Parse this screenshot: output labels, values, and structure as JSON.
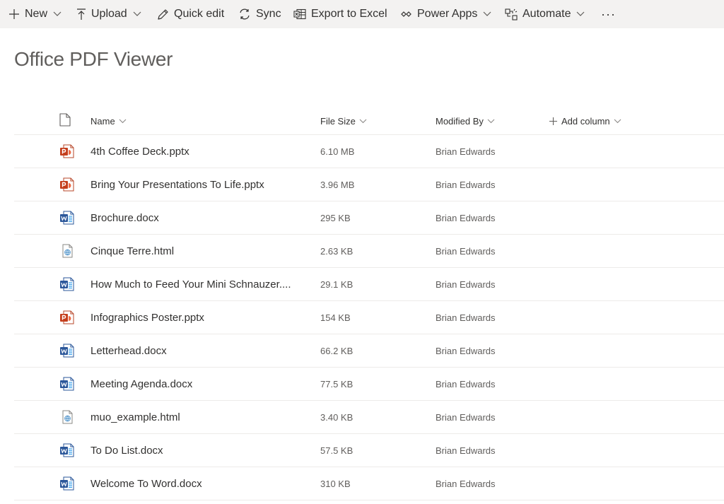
{
  "toolbar": {
    "new_label": "New",
    "upload_label": "Upload",
    "quick_edit_label": "Quick edit",
    "sync_label": "Sync",
    "export_label": "Export to Excel",
    "power_apps_label": "Power Apps",
    "automate_label": "Automate",
    "more_label": "···"
  },
  "page": {
    "title": "Office PDF Viewer"
  },
  "columns": {
    "name": "Name",
    "file_size": "File Size",
    "modified_by": "Modified By",
    "add_column": "Add column"
  },
  "colors": {
    "word": "#2b579a",
    "powerpoint": "#c43e1c",
    "html": "#4a90c8",
    "toolbar_bg": "#f3f2f1",
    "divider": "#edebe9"
  },
  "files": [
    {
      "name": "4th Coffee Deck.pptx",
      "type": "pptx",
      "size": "6.10 MB",
      "modified_by": "Brian Edwards"
    },
    {
      "name": "Bring Your Presentations To Life.pptx",
      "type": "pptx",
      "size": "3.96 MB",
      "modified_by": "Brian Edwards"
    },
    {
      "name": "Brochure.docx",
      "type": "docx",
      "size": "295 KB",
      "modified_by": "Brian Edwards"
    },
    {
      "name": "Cinque Terre.html",
      "type": "html",
      "size": "2.63 KB",
      "modified_by": "Brian Edwards"
    },
    {
      "name": "How Much to Feed Your Mini Schnauzer....",
      "type": "docx",
      "size": "29.1 KB",
      "modified_by": "Brian Edwards"
    },
    {
      "name": "Infographics Poster.pptx",
      "type": "pptx",
      "size": "154 KB",
      "modified_by": "Brian Edwards"
    },
    {
      "name": "Letterhead.docx",
      "type": "docx",
      "size": "66.2 KB",
      "modified_by": "Brian Edwards"
    },
    {
      "name": "Meeting Agenda.docx",
      "type": "docx",
      "size": "77.5 KB",
      "modified_by": "Brian Edwards"
    },
    {
      "name": "muo_example.html",
      "type": "html",
      "size": "3.40 KB",
      "modified_by": "Brian Edwards"
    },
    {
      "name": "To Do List.docx",
      "type": "docx",
      "size": "57.5 KB",
      "modified_by": "Brian Edwards"
    },
    {
      "name": "Welcome To Word.docx",
      "type": "docx",
      "size": "310 KB",
      "modified_by": "Brian Edwards"
    }
  ]
}
